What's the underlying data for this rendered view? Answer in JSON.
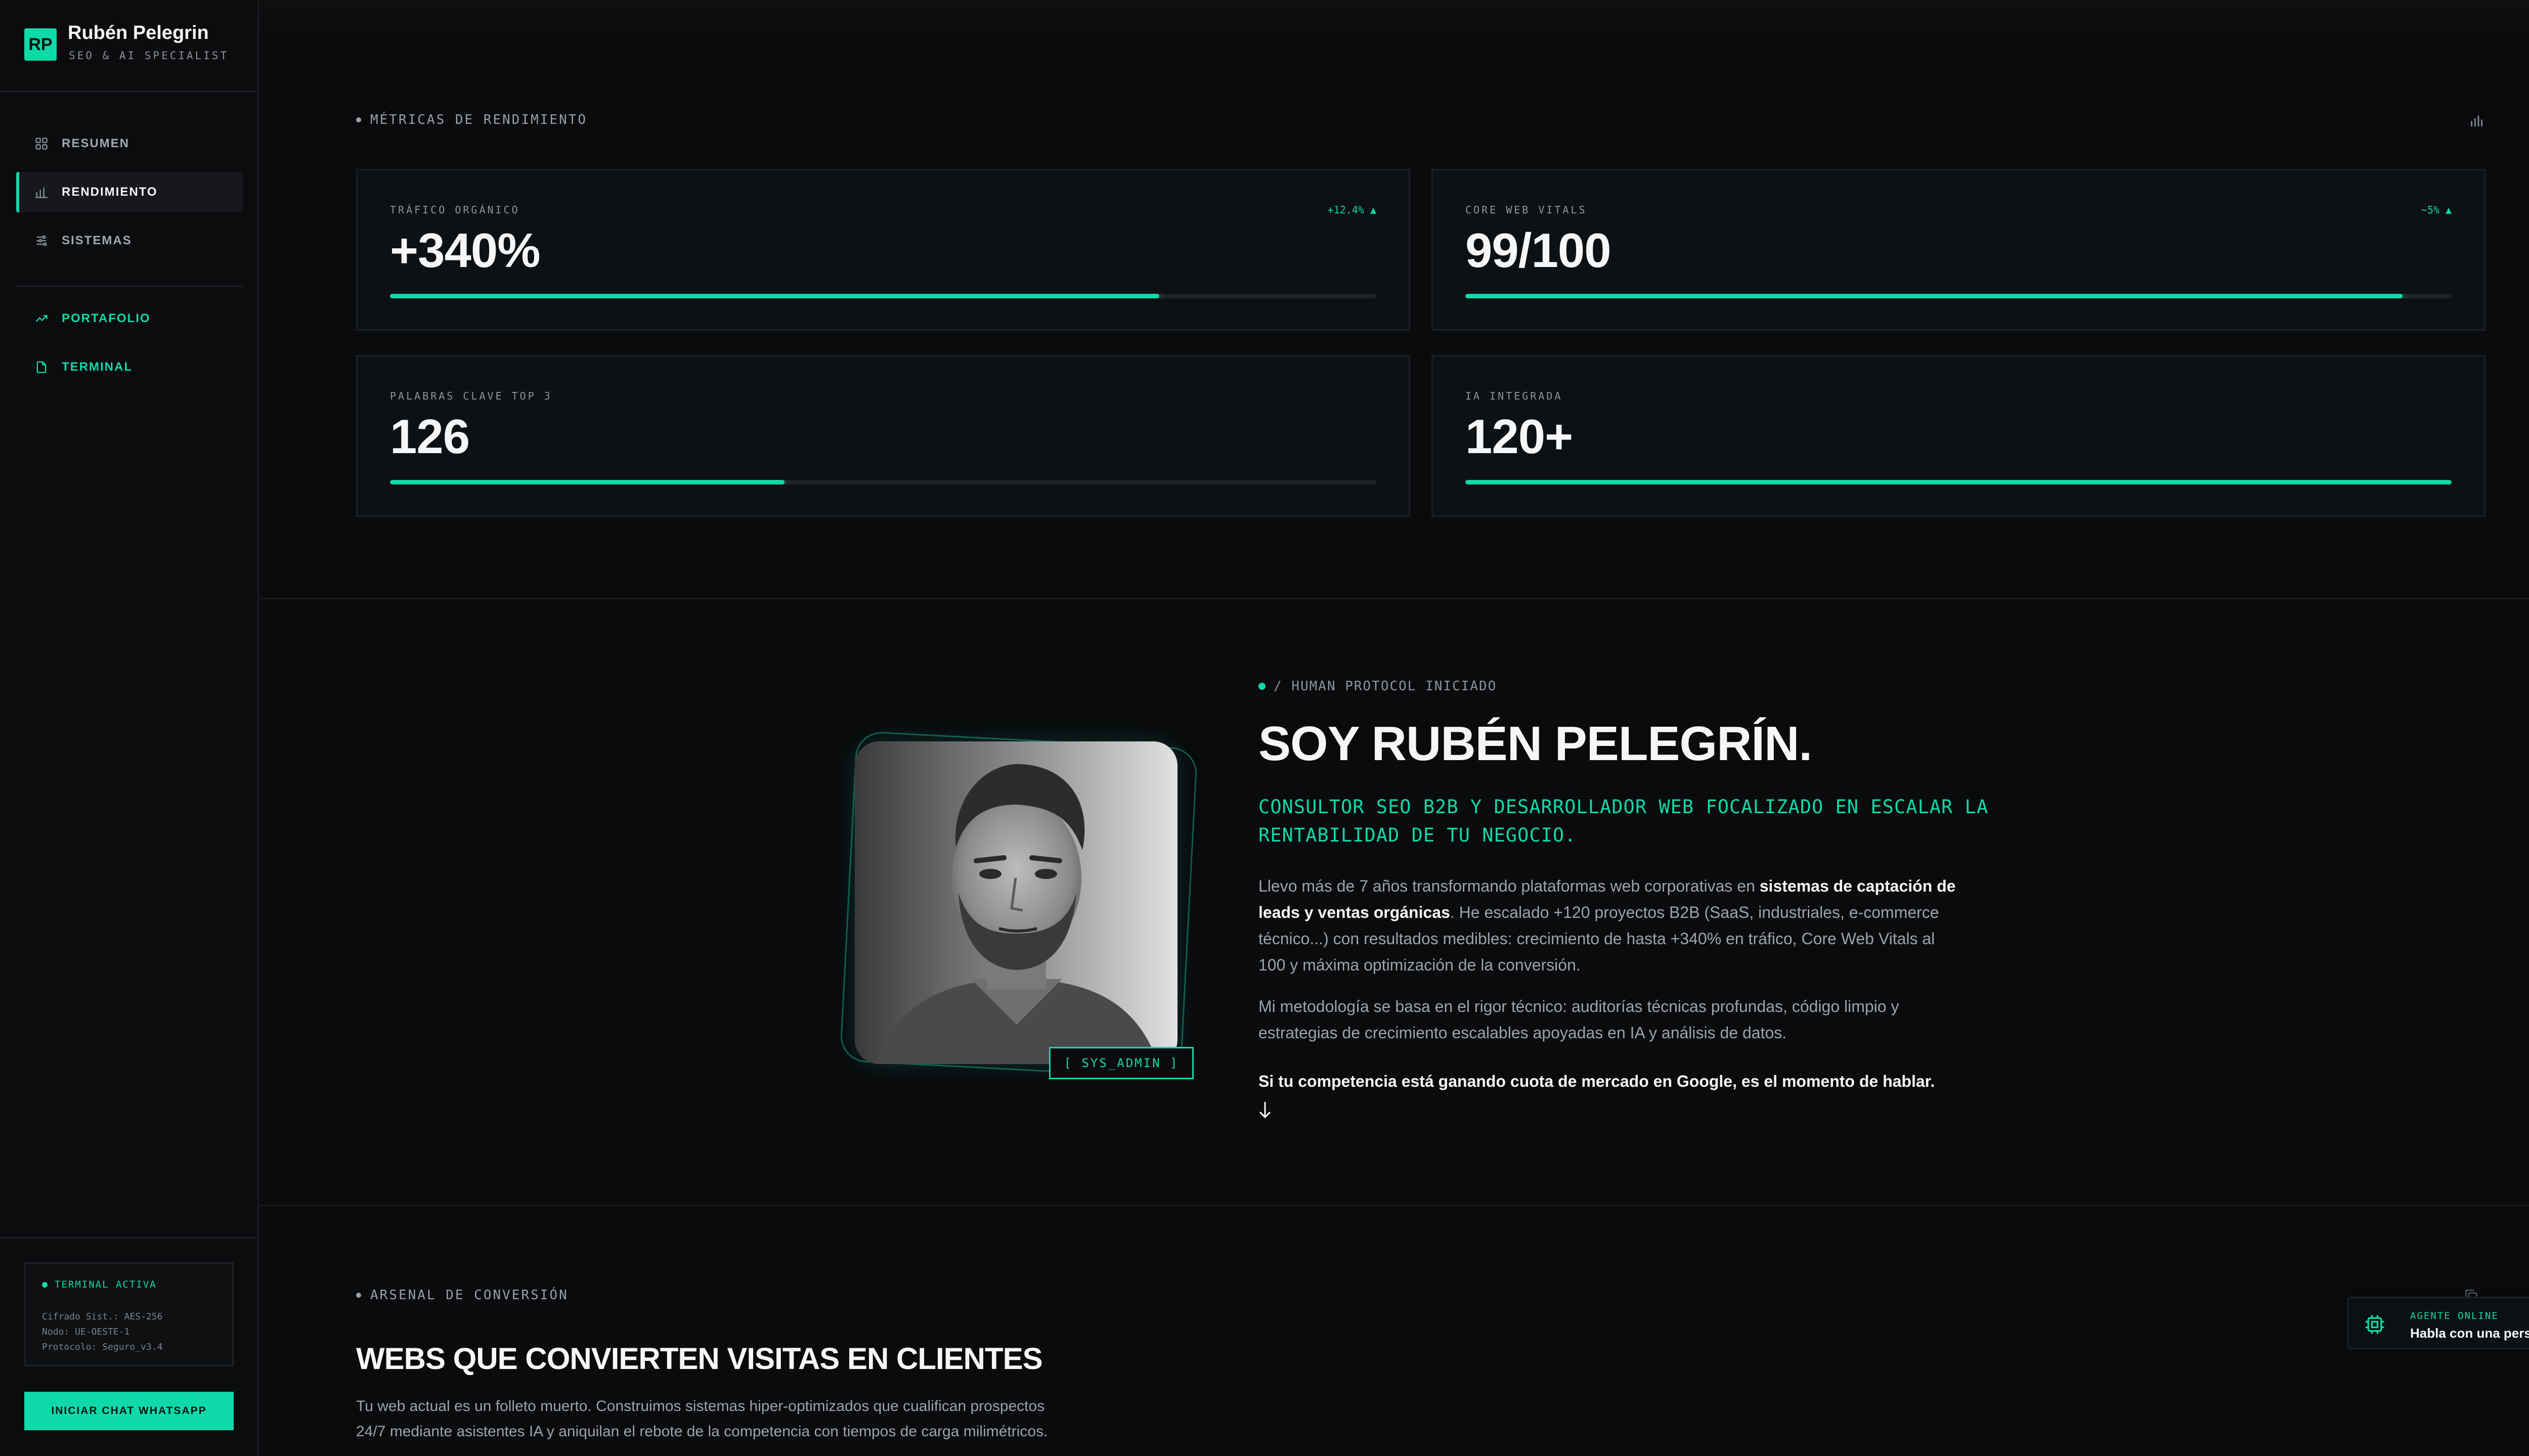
{
  "brand": {
    "logo": "RP",
    "name": "Rubén Pelegrin",
    "subtitle": "SEO & AI SPECIALIST"
  },
  "nav": {
    "resumen": "RESUMEN",
    "rendimiento": "RENDIMIENTO",
    "sistemas": "SISTEMAS",
    "portafolio": "PORTAFOLIO",
    "terminal": "TERMINAL"
  },
  "system_status": {
    "title": "TERMINAL ACTIVA",
    "lines": [
      "Cifrado Sist.: AES-256",
      "Nodo: UE-OESTE-1",
      "Protocolo: Seguro_v3.4"
    ]
  },
  "whatsapp_button": "INICIAR CHAT WHATSAPP",
  "metrics_section": {
    "label": "MÉTRICAS DE RENDIMIENTO",
    "cards": [
      {
        "label": "TRÁFICO ORGÁNICO",
        "value": "+340%",
        "delta": "+12.4% ▲",
        "progress": 0.78
      },
      {
        "label": "CORE WEB VITALS",
        "value": "99/100",
        "delta": "~5% ▲",
        "progress": 0.95
      },
      {
        "label": "PALABRAS CLAVE TOP 3",
        "value": "126",
        "delta": "",
        "progress": 0.4
      },
      {
        "label": "IA INTEGRADA",
        "value": "120+",
        "delta": "",
        "progress": 1.0
      }
    ]
  },
  "profile": {
    "badge": "[ SYS_ADMIN ]",
    "protocol": "/ HUMAN PROTOCOL INICIADO",
    "heading": "SOY RUBÉN PELEGRÍN.",
    "subtitle": "CONSULTOR SEO B2B Y DESARROLLADOR WEB FOCALIZADO EN ESCALAR LA RENTABILIDAD DE TU NEGOCIO.",
    "p1_a": "Llevo más de 7 años transformando plataformas web corporativas en ",
    "p1_b": "sistemas de captación de leads y ventas orgánicas",
    "p1_c": ". He escalado +120 proyectos B2B (SaaS, industriales, e-commerce técnico...) con resultados medibles: crecimiento de hasta +340% en tráfico, Core Web Vitals al 100 y máxima optimización de la conversión.",
    "p2": "Mi metodología se basa en el rigor técnico: auditorías técnicas profundas, código limpio y estrategias de crecimiento escalables apoyadas en IA y análisis de datos.",
    "cta": "Si tu competencia está ganando cuota de mercado en Google, es el momento de hablar."
  },
  "arsenal": {
    "label": "ARSENAL DE CONVERSIÓN",
    "heading": "WEBS QUE CONVIERTEN VISITAS EN CLIENTES",
    "text": "Tu web actual es un folleto muerto. Construimos sistemas hiper-optimizados que cualifican prospectos 24/7 mediante asistentes IA y aniquilan el rebote de la competencia con tiempos de carga milimétricos."
  },
  "agent": {
    "status": "AGENTE ONLINE",
    "cta": "Habla con una persona"
  },
  "colors": {
    "accent": "#10d9a9",
    "background": "#0a0b0d",
    "card": "#0e1113"
  }
}
